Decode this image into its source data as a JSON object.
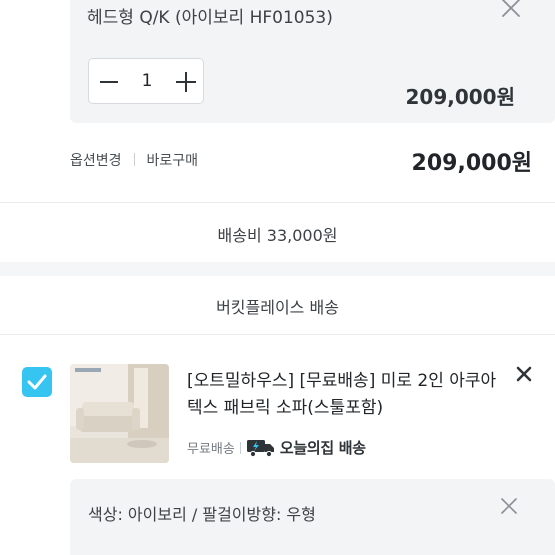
{
  "prev_item": {
    "option_name": "헤드형 Q/K (아이보리 HF01053)",
    "quantity": "1",
    "option_price": "209,000원",
    "change_option_label": "옵션변경",
    "buy_now_label": "바로구매",
    "total_price": "209,000원"
  },
  "shipping_fee": "배송비 33,000원",
  "seller": {
    "name": "버킷플레이스 배송"
  },
  "cart_item": {
    "checked": true,
    "title": "[오트밀하우스] [무료배송] 미로 2인 아쿠아텍스 패브릭 소파(스툴포함)",
    "shipping_label": "무료배송",
    "delivery_badge_text": "오늘의집 배송",
    "option_text": "색상: 아이보리 / 팔걸이방향: 우형"
  },
  "colors": {
    "accent": "#35c5f0",
    "truck": "#2f3438",
    "bolt": "#35c5f0"
  },
  "icons": [
    "close-icon",
    "minus-icon",
    "plus-icon",
    "check-icon",
    "truck-icon"
  ]
}
